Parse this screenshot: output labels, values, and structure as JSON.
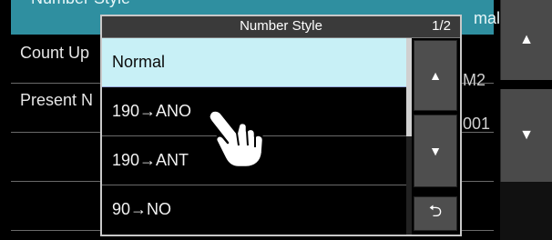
{
  "background": {
    "header_title": "Number Style",
    "header_value": "mal",
    "rows": [
      {
        "label": "Count Up",
        "value": "M2"
      },
      {
        "label": "Present N",
        "value": "001"
      }
    ]
  },
  "side_buttons": {
    "up_glyph": "▲",
    "down_glyph": "▼"
  },
  "dialog": {
    "title": "Number Style",
    "page": "1/2",
    "items": [
      {
        "label": "Normal",
        "selected": true
      },
      {
        "label": "190→ANO",
        "selected": false
      },
      {
        "label": "190→ANT",
        "selected": false
      },
      {
        "label": "90→NO",
        "selected": false
      }
    ],
    "up_glyph": "▲",
    "down_glyph": "▼",
    "return_glyph": "⮌"
  },
  "colors": {
    "header_accent": "#2f8fa0",
    "selected_row": "#c8f0f6"
  },
  "icons": [
    "pointing-hand-icon",
    "return-icon",
    "up-arrow-icon",
    "down-arrow-icon"
  ]
}
